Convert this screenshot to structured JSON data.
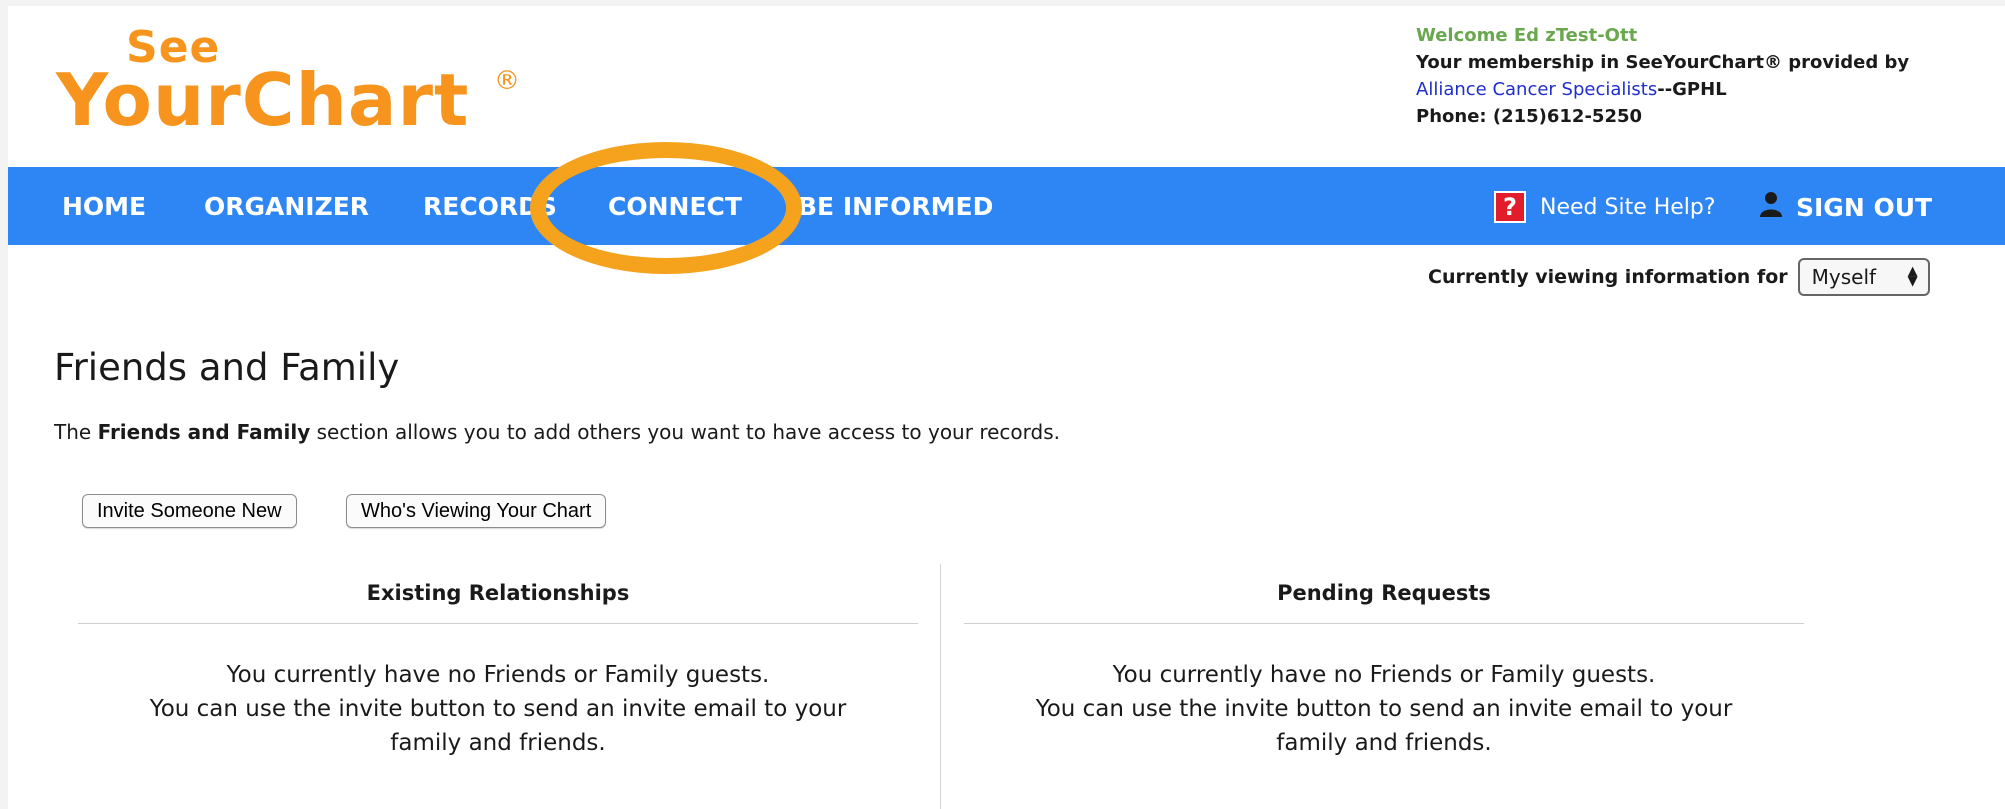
{
  "header": {
    "logo_top": "See",
    "logo_main": "YourChart",
    "logo_reg": "®",
    "welcome": "Welcome Ed zTest-Ott",
    "membership": "Your membership in SeeYourChart® provided by",
    "provider_link": "Alliance Cancer Specialists",
    "provider_suffix": "--GPHL",
    "phone": "Phone: (215)612-5250"
  },
  "nav": {
    "home": "HOME",
    "organizer": "ORGANIZER",
    "records": "RECORDS",
    "connect": "CONNECT",
    "informed": "BE INFORMED",
    "help": "Need Site Help?",
    "help_icon": "?",
    "signout": "SIGN OUT"
  },
  "viewing": {
    "label": "Currently viewing information for",
    "selected": "Myself"
  },
  "main": {
    "title": "Friends and Family",
    "intro_prefix": "The ",
    "intro_bold": "Friends and Family",
    "intro_suffix": " section allows you to add others you want to have access to your records.",
    "invite_button": "Invite Someone New",
    "viewing_button": "Who's Viewing Your Chart",
    "existing": {
      "heading": "Existing Relationships",
      "line1": "You currently have no Friends or Family guests.",
      "line2": "You can use the invite button to send an invite email to your family and friends."
    },
    "pending": {
      "heading": "Pending Requests",
      "line1": "You currently have no Friends or Family guests.",
      "line2": "You can use the invite button to send an invite email to your family and friends."
    }
  },
  "colors": {
    "brand_orange": "#f7941d",
    "nav_blue": "#2e86f5",
    "welcome_green": "#6aa84f",
    "link_blue": "#1f2ecc",
    "help_red": "#e21d2b",
    "highlight_orange": "#f5a31c"
  },
  "icons": {
    "help": "help-icon",
    "signout": "person-icon",
    "select_arrows": "updown-arrows-icon"
  }
}
